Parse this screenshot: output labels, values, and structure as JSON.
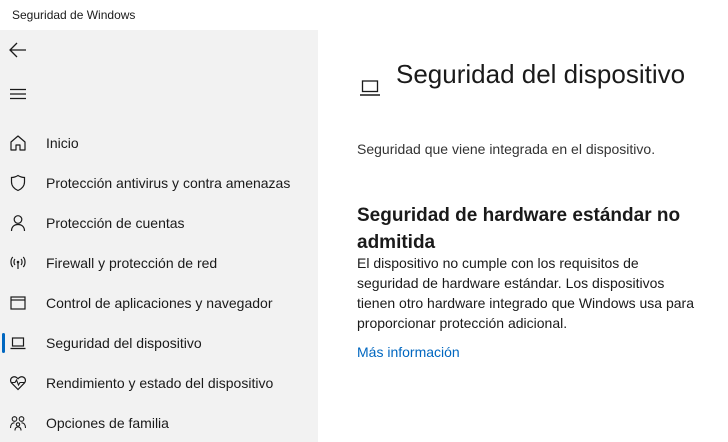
{
  "window": {
    "title": "Seguridad de Windows"
  },
  "sidebar": {
    "items": [
      {
        "label": "Inicio",
        "icon": "home-icon",
        "active": false
      },
      {
        "label": "Protección antivirus y contra amenazas",
        "icon": "shield-icon",
        "active": false
      },
      {
        "label": "Protección de cuentas",
        "icon": "person-icon",
        "active": false
      },
      {
        "label": "Firewall y protección de red",
        "icon": "wireless-icon",
        "active": false
      },
      {
        "label": "Control de aplicaciones y navegador",
        "icon": "app-browser-icon",
        "active": false
      },
      {
        "label": "Seguridad del dispositivo",
        "icon": "laptop-icon",
        "active": true
      },
      {
        "label": "Rendimiento y estado del dispositivo",
        "icon": "heart-pulse-icon",
        "active": false
      },
      {
        "label": "Opciones de familia",
        "icon": "family-icon",
        "active": false
      }
    ]
  },
  "main": {
    "title": "Seguridad del dispositivo",
    "subtitle": "Seguridad que viene integrada en el dispositivo.",
    "section_title": "Seguridad de hardware estándar no admitida",
    "section_body": "El dispositivo no cumple con los requisitos de seguridad de hardware estándar. Los dispositivos tienen otro hardware integrado que Windows usa para proporcionar protección adicional.",
    "link": "Más información"
  },
  "colors": {
    "accent": "#0067c0",
    "sidebar_bg": "#f2f2f2",
    "content_bg": "#ffffff"
  }
}
